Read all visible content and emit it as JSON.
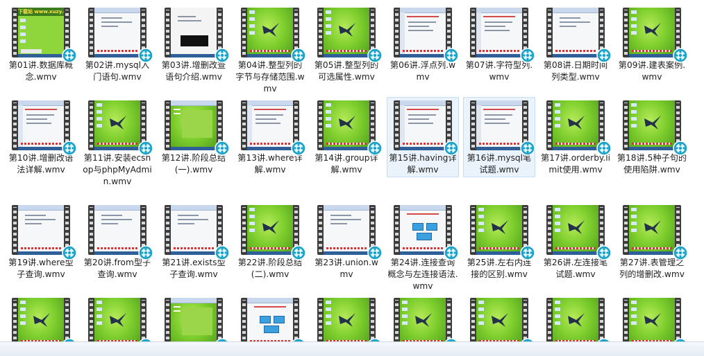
{
  "window": {
    "view": "large-icons"
  },
  "colors": {
    "selected_bg": "#eaf3fc",
    "selected_border": "#c5dcf3",
    "badge": "#1aa3c9"
  },
  "files": [
    {
      "name": "第01讲.数据库概念.wmv",
      "thumb": "banner",
      "banner_text": "下载站 www.xuzy.com"
    },
    {
      "name": "第02讲.mysql入门语句.wmv",
      "thumb": "doc"
    },
    {
      "name": "第03讲.增删改查语句介绍.wmv",
      "thumb": "term"
    },
    {
      "name": "第04讲.整型列的字节与存储范围.wmv",
      "thumb": "bird"
    },
    {
      "name": "第05讲.整型列的可选属性.wmv",
      "thumb": "bird"
    },
    {
      "name": "第06讲.浮点列.wmv",
      "thumb": "slide"
    },
    {
      "name": "第07讲.字符型列.wmv",
      "thumb": "slide"
    },
    {
      "name": "第08讲.日期时间列类型.wmv",
      "thumb": "doc"
    },
    {
      "name": "第09讲.建表案例.wmv",
      "thumb": "bird"
    },
    {
      "name": "第10讲.增删改语法详解.wmv",
      "thumb": "slide"
    },
    {
      "name": "第11讲.安装ecshop与phpMyAdmin.wmv",
      "thumb": "bird"
    },
    {
      "name": "第12讲.阶段总结(一).wmv",
      "thumb": "window"
    },
    {
      "name": "第13讲.where详解.wmv",
      "thumb": "slide"
    },
    {
      "name": "第14讲.group详解.wmv",
      "thumb": "bird"
    },
    {
      "name": "第15讲.having详解.wmv",
      "thumb": "slide",
      "selected": true
    },
    {
      "name": "第16讲.mysql笔试题.wmv",
      "thumb": "slide",
      "selected": true
    },
    {
      "name": "第17讲.orderby.limit使用.wmv",
      "thumb": "bird"
    },
    {
      "name": "第18讲.5种子句的使用陷阱.wmv",
      "thumb": "bird"
    },
    {
      "name": "第19讲.where型子查询.wmv",
      "thumb": "doc"
    },
    {
      "name": "第20讲.from型子查询.wmv",
      "thumb": "doc"
    },
    {
      "name": "第21讲.exists型子查询.wmv",
      "thumb": "doc"
    },
    {
      "name": "第22讲.阶段总结(二).wmv",
      "thumb": "bird"
    },
    {
      "name": "第23讲.union.wmv",
      "thumb": "doc"
    },
    {
      "name": "第24讲.连接查询概念与左连接语法.wmv",
      "thumb": "diagram"
    },
    {
      "name": "第25讲.左右内连接的区别.wmv",
      "thumb": "bird"
    },
    {
      "name": "第26讲.左连接笔试题.wmv",
      "thumb": "bird"
    },
    {
      "name": "第27讲.表管理之列的增删改.wmv",
      "thumb": "bird"
    },
    {
      "name": "",
      "thumb": "bird"
    },
    {
      "name": "",
      "thumb": "bird"
    },
    {
      "name": "",
      "thumb": "window"
    },
    {
      "name": "",
      "thumb": "diagram"
    },
    {
      "name": "",
      "thumb": "bird"
    },
    {
      "name": "",
      "thumb": "bird"
    },
    {
      "name": "",
      "thumb": "bird"
    },
    {
      "name": "",
      "thumb": "bird"
    },
    {
      "name": "",
      "thumb": "bird"
    }
  ]
}
